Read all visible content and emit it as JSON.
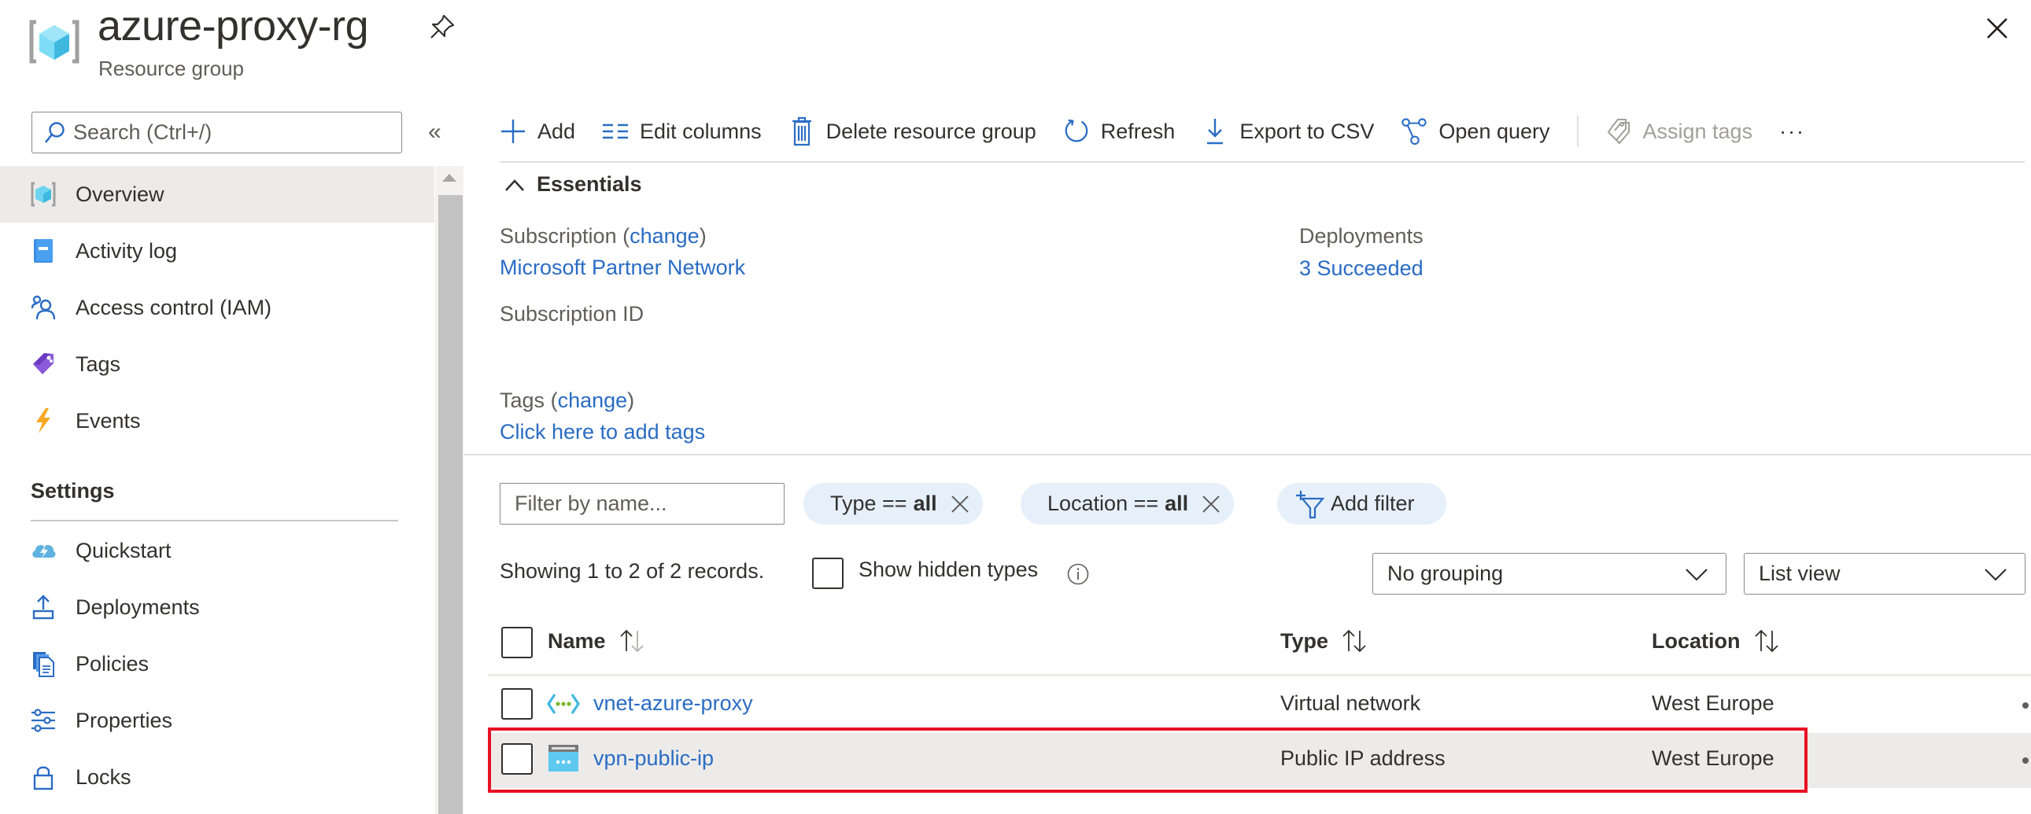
{
  "header": {
    "title": "azure-proxy-rg",
    "subtitle": "Resource group",
    "pin_icon": "pin-icon",
    "close_icon": "close-icon"
  },
  "sidebar": {
    "search_placeholder": "Search (Ctrl+/)",
    "collapse_glyph": "«",
    "items": [
      {
        "label": "Overview",
        "icon": "resource-group-icon",
        "active": true
      },
      {
        "label": "Activity log",
        "icon": "activity-log-icon"
      },
      {
        "label": "Access control (IAM)",
        "icon": "iam-people-icon"
      },
      {
        "label": "Tags",
        "icon": "tag-icon"
      },
      {
        "label": "Events",
        "icon": "lightning-icon"
      }
    ],
    "section_title": "Settings",
    "settings_items": [
      {
        "label": "Quickstart",
        "icon": "cloud-lightning-icon"
      },
      {
        "label": "Deployments",
        "icon": "upload-icon"
      },
      {
        "label": "Policies",
        "icon": "policy-document-icon"
      },
      {
        "label": "Properties",
        "icon": "sliders-icon"
      },
      {
        "label": "Locks",
        "icon": "lock-icon"
      }
    ]
  },
  "toolbar": {
    "add": "Add",
    "edit_columns": "Edit columns",
    "delete_group": "Delete resource group",
    "refresh": "Refresh",
    "export_csv": "Export to CSV",
    "open_query": "Open query",
    "assign_tags": "Assign tags",
    "more": "···"
  },
  "essentials": {
    "toggle_label": "Essentials",
    "subscription_label": "Subscription",
    "change_link": "change",
    "subscription_value": "Microsoft Partner Network",
    "subscription_id_label": "Subscription ID",
    "deployments_label": "Deployments",
    "deployments_value": "3 Succeeded",
    "tags_label": "Tags",
    "tags_change": "change",
    "tags_value": "Click here to add tags",
    "paren_open": "(",
    "paren_close": ")"
  },
  "filters": {
    "name_placeholder": "Filter by name...",
    "type_pill_prefix": "Type ==",
    "type_pill_value": "all",
    "location_pill_prefix": "Location ==",
    "location_pill_value": "all",
    "add_filter": "Add filter"
  },
  "records": {
    "summary": "Showing 1 to 2 of 2 records.",
    "show_hidden_label": "Show hidden types",
    "show_hidden_checked": false,
    "grouping_value": "No grouping",
    "view_value": "List view"
  },
  "table": {
    "columns": [
      "Name",
      "Type",
      "Location"
    ],
    "rows": [
      {
        "name": "vnet-azure-proxy",
        "type": "Virtual network",
        "location": "West Europe",
        "icon": "virtual-network-icon",
        "selected": false
      },
      {
        "name": "vpn-public-ip",
        "type": "Public IP address",
        "location": "West Europe",
        "icon": "public-ip-icon",
        "selected": true,
        "highlighted": true
      }
    ]
  },
  "colors": {
    "link": "#2a6cc4",
    "accent": "#0078d4",
    "highlight_box": "#e81123",
    "selected_row": "#edebe9",
    "pill_bg": "#e6f0fa"
  }
}
